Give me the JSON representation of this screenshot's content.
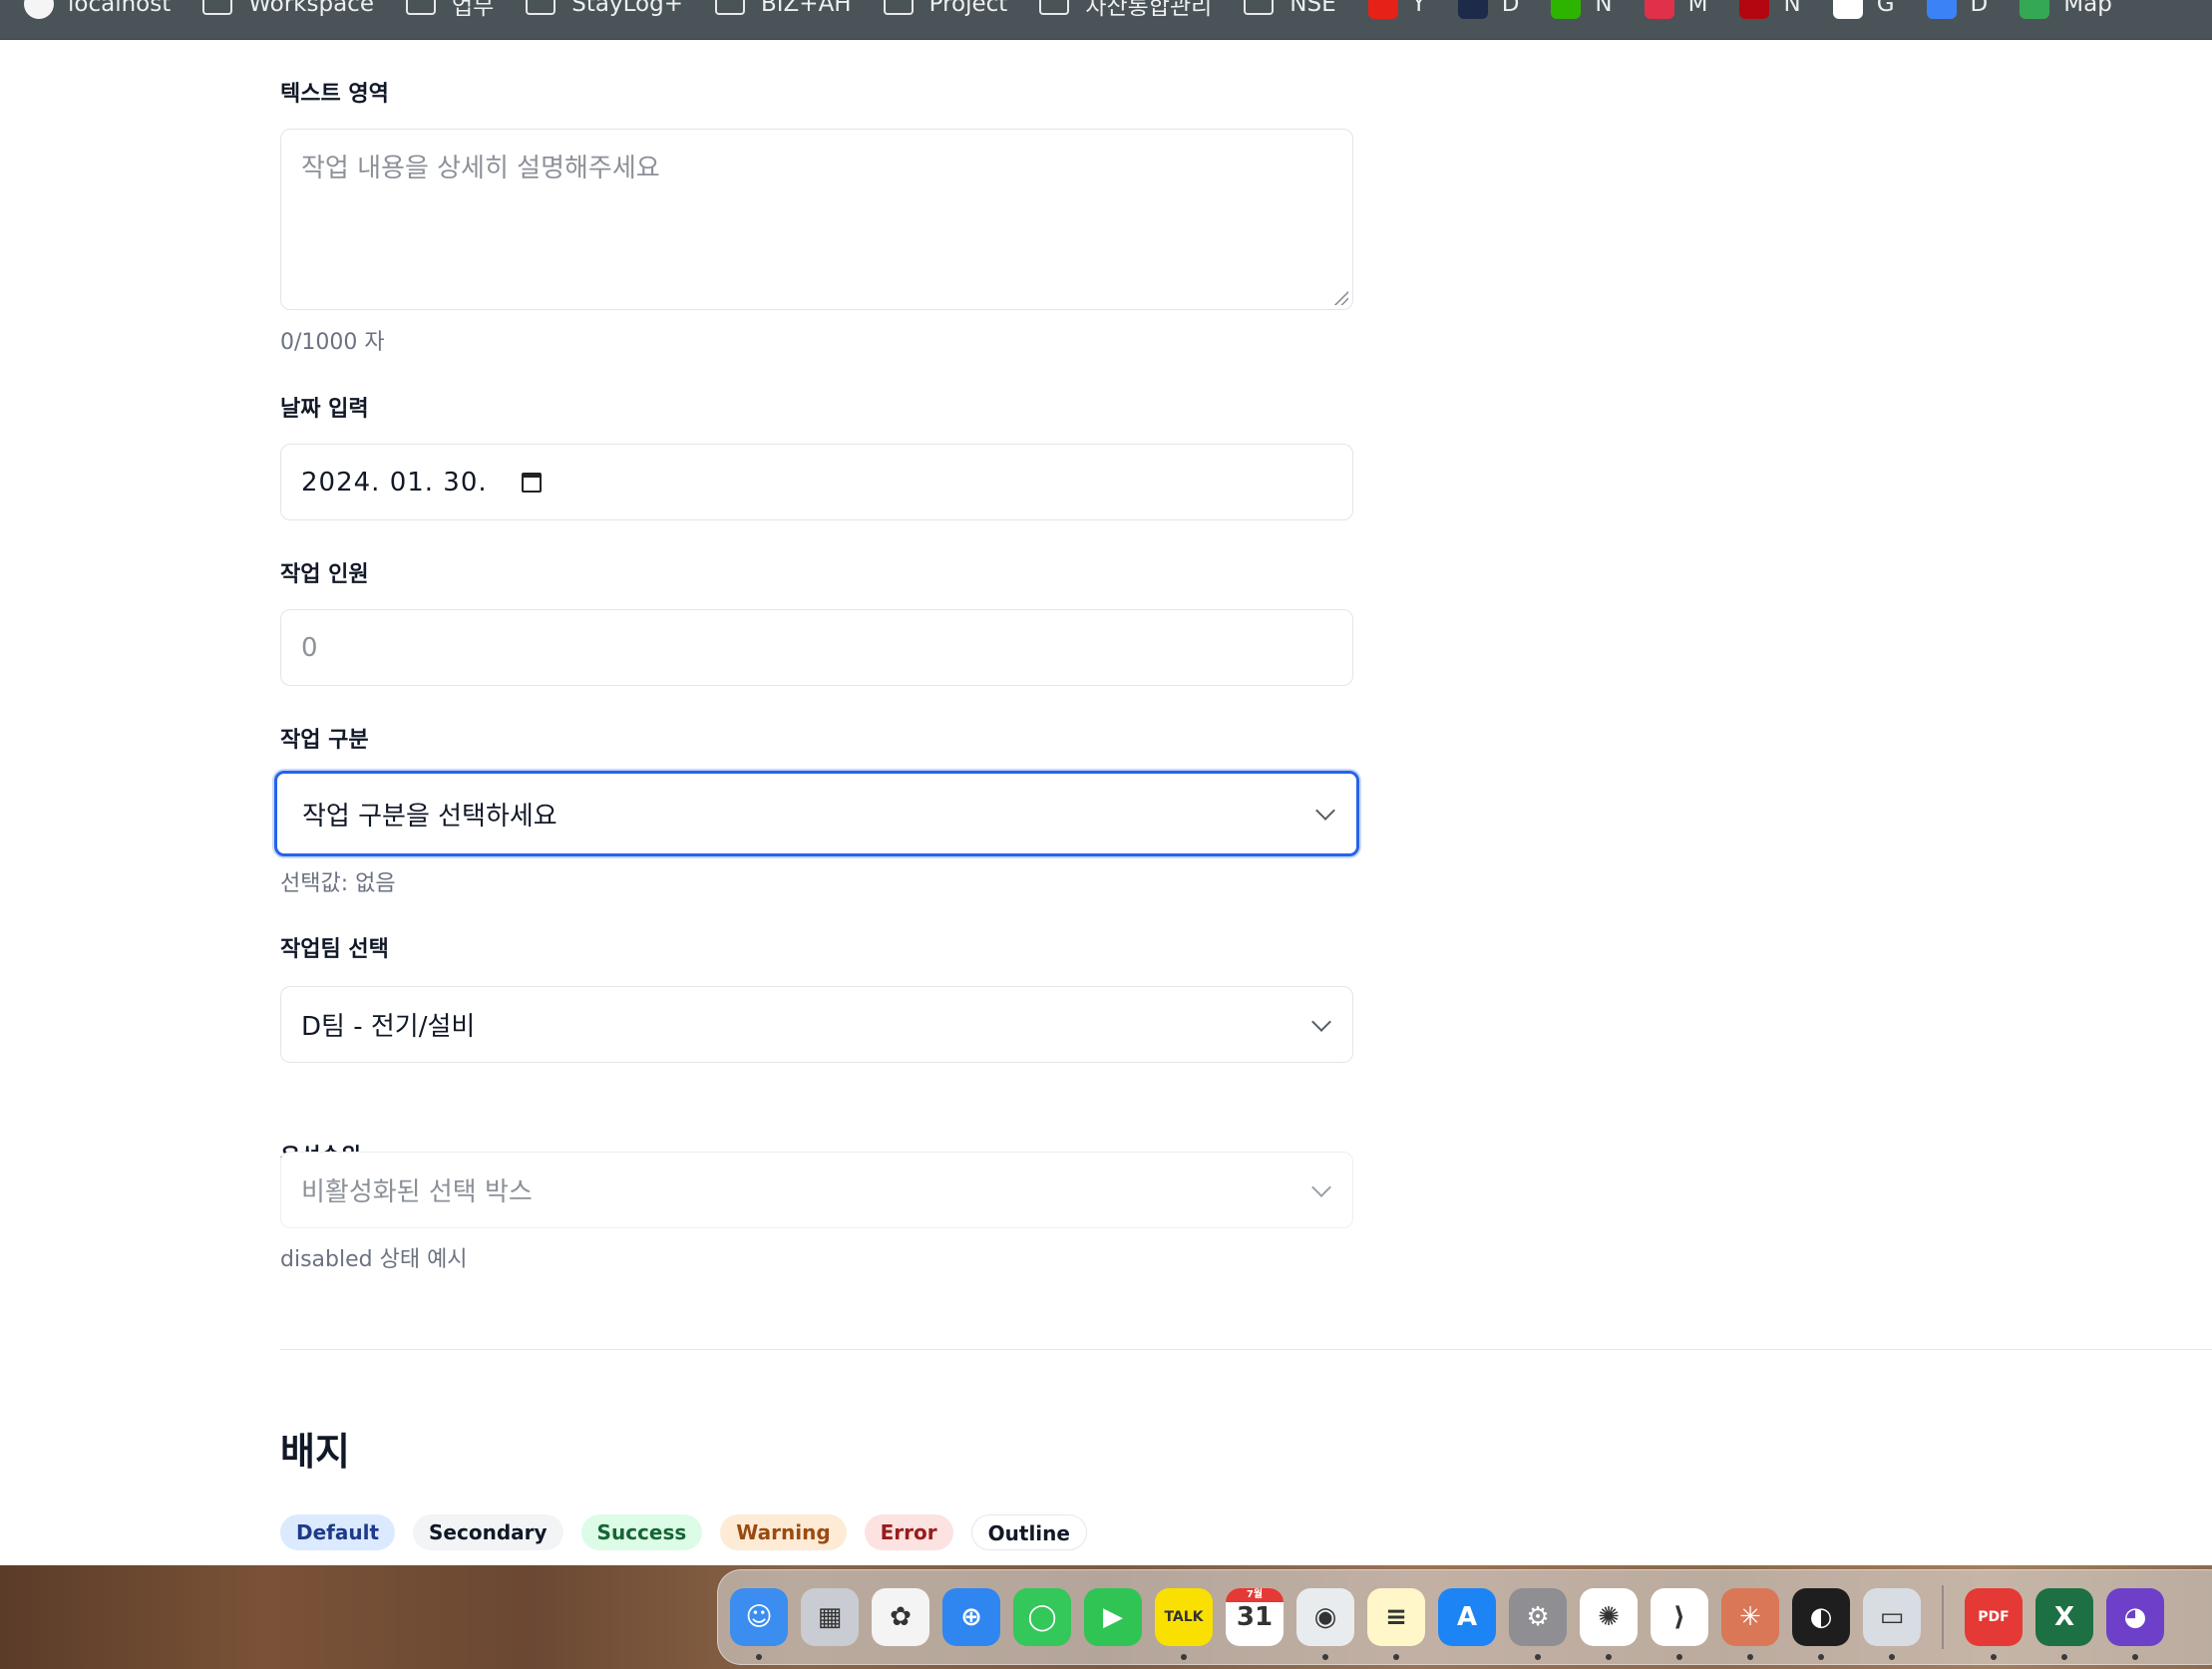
{
  "bookmarks": [
    {
      "icon": "globe-icon",
      "label": "localhost"
    },
    {
      "icon": "folder-icon",
      "label": "Workspace"
    },
    {
      "icon": "folder-icon",
      "label": "업무"
    },
    {
      "icon": "folder-icon",
      "label": "StayLog+"
    },
    {
      "icon": "folder-icon",
      "label": "BIZ+AH"
    },
    {
      "icon": "folder-icon",
      "label": "Project"
    },
    {
      "icon": "folder-icon",
      "label": "자산통합관리"
    },
    {
      "icon": "folder-icon",
      "label": "NSE"
    },
    {
      "icon": "youtube-icon",
      "label": "Y",
      "color": "#e62117"
    },
    {
      "icon": "d-icon",
      "label": "D",
      "color": "#1d2a4a"
    },
    {
      "icon": "naver-icon",
      "label": "N",
      "color": "#2db400"
    },
    {
      "icon": "m-icon",
      "label": "M",
      "color": "#e0314b"
    },
    {
      "icon": "netflix-icon",
      "label": "N",
      "color": "#b20710"
    },
    {
      "icon": "google-icon",
      "label": "G",
      "color": "#ffffff"
    },
    {
      "icon": "drive-icon",
      "label": "D",
      "color": "#3b82f6"
    },
    {
      "icon": "maps-icon",
      "label": "Map",
      "color": "#34a853"
    }
  ],
  "form": {
    "textarea": {
      "label": "텍스트 영역",
      "placeholder": "작업 내용을 상세히 설명해주세요",
      "counter": "0/1000 자"
    },
    "date": {
      "label": "날짜 입력",
      "value": "2024. 01. 30."
    },
    "workers": {
      "label": "작업 인원",
      "placeholder": "0"
    },
    "category": {
      "label": "작업 구분",
      "value": "작업 구분을 선택하세요",
      "helper": "선택값: 없음"
    },
    "team": {
      "label": "작업팀 선택",
      "value": "D팀 - 전기/설비"
    },
    "priority": {
      "label": "우선순위",
      "value": "비활성화된 선택 박스",
      "helper": "disabled 상태 예시"
    }
  },
  "badges_section": {
    "title": "배지",
    "badges": [
      {
        "label": "Default",
        "bg": "#dbeafe",
        "fg": "#1e3a8a"
      },
      {
        "label": "Secondary",
        "bg": "#f3f4f6",
        "fg": "#111827"
      },
      {
        "label": "Success",
        "bg": "#dcfce7",
        "fg": "#166534"
      },
      {
        "label": "Warning",
        "bg": "#fdebd6",
        "fg": "#9a4b12"
      },
      {
        "label": "Error",
        "bg": "#fde2e2",
        "fg": "#991b1b"
      },
      {
        "label": "Outline",
        "bg": "#ffffff",
        "fg": "#111827"
      }
    ]
  },
  "dock": {
    "apps": [
      {
        "name": "finder-icon",
        "glyph": "☺",
        "color": "#3b8df0",
        "running": true
      },
      {
        "name": "launchpad-icon",
        "glyph": "▦",
        "color": "#c9ccd2",
        "running": false
      },
      {
        "name": "photos-icon",
        "glyph": "✿",
        "color": "#f4f4f4",
        "running": false
      },
      {
        "name": "safari-icon",
        "glyph": "⊕",
        "color": "#2f86f0",
        "running": false
      },
      {
        "name": "messages-icon",
        "glyph": "◯",
        "color": "#34c759",
        "running": false
      },
      {
        "name": "facetime-icon",
        "glyph": "▶",
        "color": "#30c454",
        "running": false
      },
      {
        "name": "kakaotalk-icon",
        "glyph": "TALK",
        "color": "#f9e000",
        "running": true
      },
      {
        "name": "calendar-icon",
        "glyph": "31",
        "color": "#ffffff",
        "month": "7월",
        "running": false
      },
      {
        "name": "chrome-icon",
        "glyph": "◉",
        "color": "#e9ecef",
        "running": true
      },
      {
        "name": "notes-icon",
        "glyph": "≡",
        "color": "#fff6c9",
        "running": true
      },
      {
        "name": "appstore-icon",
        "glyph": "A",
        "color": "#1c84f5",
        "running": false
      },
      {
        "name": "settings-icon",
        "glyph": "⚙",
        "color": "#8e8e93",
        "running": true
      },
      {
        "name": "chatgpt-icon",
        "glyph": "✺",
        "color": "#ffffff",
        "running": true
      },
      {
        "name": "vscode-icon",
        "glyph": "⟩",
        "color": "#ffffff",
        "running": true
      },
      {
        "name": "claude-icon",
        "glyph": "✳",
        "color": "#d97757",
        "running": true
      },
      {
        "name": "figma-icon",
        "glyph": "◐",
        "color": "#1e1e1e",
        "running": true
      },
      {
        "name": "preview-icon",
        "glyph": "▭",
        "color": "#d8dde4",
        "running": true
      },
      {
        "name": "pdf-icon",
        "glyph": "PDF",
        "color": "#e53935",
        "running": true
      },
      {
        "name": "excel-icon",
        "glyph": "X",
        "color": "#1d7044",
        "running": true
      },
      {
        "name": "github-icon",
        "glyph": "◕",
        "color": "#6e40c9",
        "running": true
      }
    ]
  }
}
